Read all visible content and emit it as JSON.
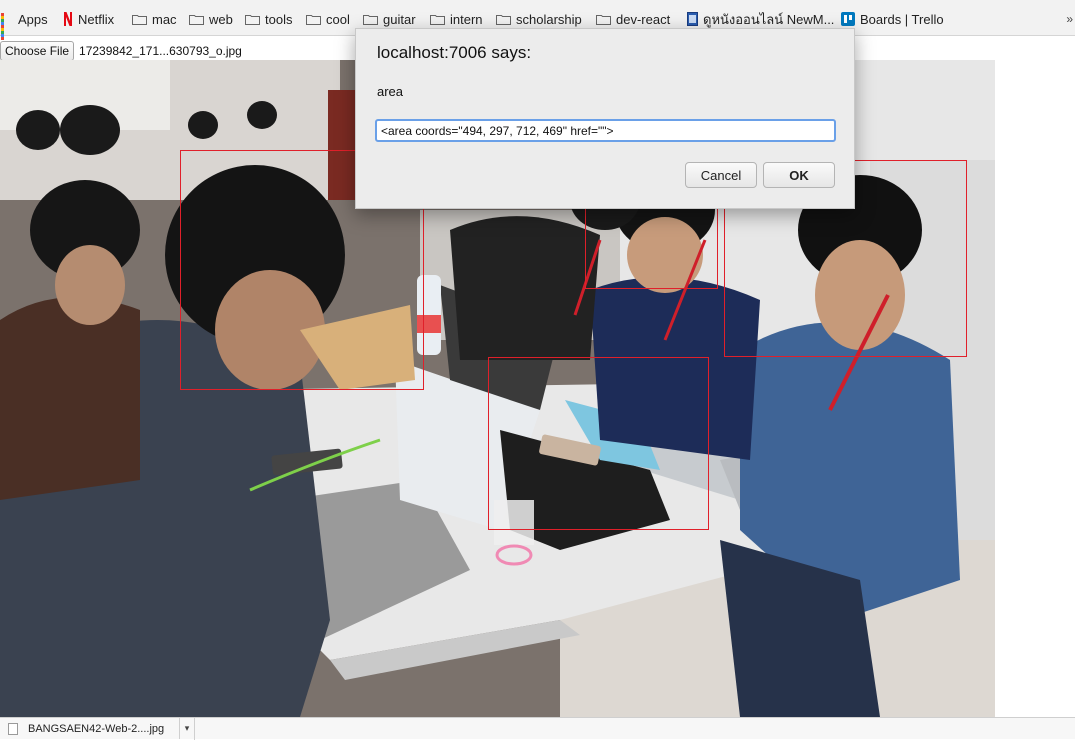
{
  "bookmarks": [
    {
      "label": "Apps",
      "icon": "apps-icon"
    },
    {
      "label": "Netflix",
      "icon": "netflix-icon"
    },
    {
      "label": "mac",
      "icon": "folder-icon"
    },
    {
      "label": "web",
      "icon": "folder-icon"
    },
    {
      "label": "tools",
      "icon": "folder-icon"
    },
    {
      "label": "cool",
      "icon": "folder-icon"
    },
    {
      "label": "guitar",
      "icon": "folder-icon"
    },
    {
      "label": "intern",
      "icon": "folder-icon"
    },
    {
      "label": "scholarship",
      "icon": "folder-icon"
    },
    {
      "label": "dev-react",
      "icon": "folder-icon"
    },
    {
      "label": "ดูหนังออนไลน์ NewM...",
      "icon": "film-icon"
    },
    {
      "label": "Boards | Trello",
      "icon": "trello-icon"
    }
  ],
  "overflow": "»",
  "file_input": {
    "button_label": "Choose File",
    "file_name": "17239842_171...630793_o.jpg"
  },
  "dialog": {
    "title": "localhost:7006 says:",
    "message": "area",
    "input_value": "<area coords=\"494, 297, 712, 469\" href=\"\">",
    "cancel_label": "Cancel",
    "ok_label": "OK"
  },
  "download": {
    "file_name": "BANGSAEN42-Web-2....jpg",
    "caret": "▾"
  },
  "colors": {
    "map_rect": "#e0202a",
    "input_focus": "#6aa0e8"
  }
}
